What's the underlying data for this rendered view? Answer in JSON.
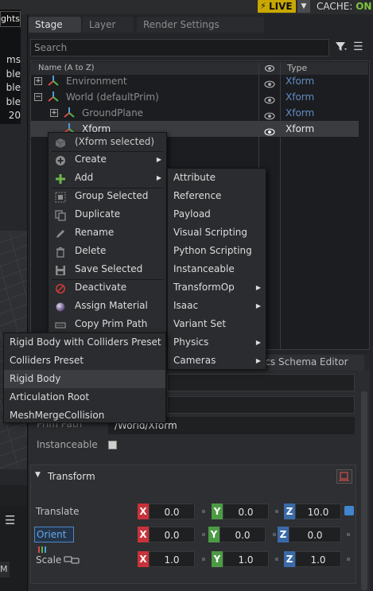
{
  "topbar": {
    "live_label": "LIVE",
    "cache_label": "CACHE: ",
    "cache_state": "ON",
    "colors": {
      "live_bg": "#c8a800",
      "cache_on": "#7ec43c"
    }
  },
  "viewport": {
    "lights_label": "ghts",
    "lines": [
      "ms",
      "ble",
      "ble",
      "ble",
      "20"
    ],
    "bottom_letter": "M"
  },
  "stage": {
    "tabs": [
      {
        "label": "Stage",
        "active": true
      },
      {
        "label": "Layer",
        "active": false
      },
      {
        "label": "Render Settings",
        "active": false
      }
    ],
    "search_placeholder": "Search",
    "columns": {
      "name": "Name (A to Z)",
      "type": "Type"
    },
    "rows": [
      {
        "label": "Environment",
        "type": "Xform",
        "expander": "+",
        "selected": false
      },
      {
        "label": "World (defaultPrim)",
        "type": "Xform",
        "expander": "−",
        "selected": false
      },
      {
        "label": "GroundPlane",
        "type": "Xform",
        "expander": "+",
        "selected": false
      },
      {
        "label": "Xform",
        "type": "Xform",
        "expander": "",
        "selected": true
      }
    ]
  },
  "context_menu": {
    "items": [
      {
        "label": "(Xform selected)",
        "icon": "cube-icon"
      },
      {
        "label": "Create",
        "icon": "plus-circle-icon",
        "submenu": true
      },
      {
        "label": "Add",
        "icon": "plus-icon",
        "submenu": true
      },
      {
        "label": "Group Selected",
        "icon": "group-icon"
      },
      {
        "label": "Duplicate",
        "icon": "duplicate-icon"
      },
      {
        "label": "Rename",
        "icon": "pencil-icon"
      },
      {
        "label": "Delete",
        "icon": "trash-icon"
      },
      {
        "label": "Save Selected",
        "icon": "save-icon"
      },
      {
        "label": "Deactivate",
        "icon": "deactivate-icon"
      },
      {
        "label": "Assign Material",
        "icon": "material-sphere-icon"
      },
      {
        "label": "Copy Prim Path",
        "icon": "copy-path-icon"
      }
    ]
  },
  "add_menu": {
    "items": [
      {
        "label": "Attribute",
        "submenu": false
      },
      {
        "label": "Reference",
        "submenu": false
      },
      {
        "label": "Payload",
        "submenu": false
      },
      {
        "label": "Visual Scripting",
        "submenu": false
      },
      {
        "label": "Python Scripting",
        "submenu": false
      },
      {
        "label": "Instanceable",
        "submenu": false
      },
      {
        "label": "TransformOp",
        "submenu": true
      },
      {
        "label": "Isaac",
        "submenu": true
      },
      {
        "label": "Variant Set",
        "submenu": false
      },
      {
        "label": "Physics",
        "submenu": true
      },
      {
        "label": "Cameras",
        "submenu": true
      }
    ]
  },
  "physics_menu": {
    "items": [
      {
        "label": "Rigid Body with Colliders Preset",
        "highlighted": false
      },
      {
        "label": "Colliders Preset",
        "highlighted": false
      },
      {
        "label": "Rigid Body",
        "highlighted": true
      },
      {
        "label": "Articulation Root",
        "highlighted": false
      },
      {
        "label": "MeshMergeCollision",
        "highlighted": false
      }
    ]
  },
  "property": {
    "physics_tab_label": "ics Schema Editor",
    "prim_path_label": "Prim Path",
    "prim_path_value": "/World/Xform",
    "instanceable_label": "Instanceable",
    "transform_title": "Transform",
    "translate": {
      "label": "Translate",
      "x": "0.0",
      "y": "0.0",
      "z": "10.0"
    },
    "orient": {
      "label": "Orient",
      "x": "0.0",
      "y": "0.0",
      "z": "0.0"
    },
    "scale": {
      "label": "Scale",
      "x": "1.0",
      "y": "1.0",
      "z": "1.0"
    },
    "axis_labels": {
      "x": "X",
      "y": "Y",
      "z": "Z"
    }
  }
}
